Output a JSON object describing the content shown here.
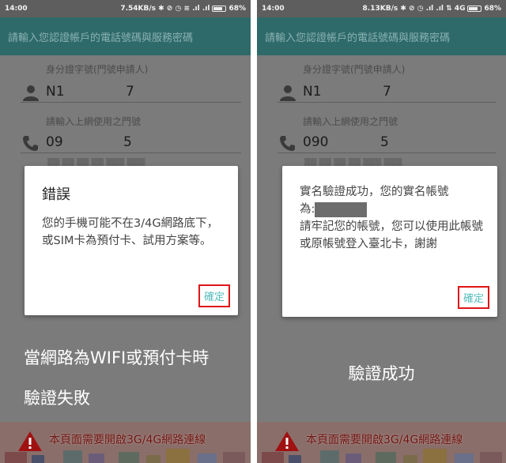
{
  "left": {
    "status": {
      "time": "14:00",
      "right": "7.54KB/s ✱ ⊘ ◷ ≋ .ıl .ıl",
      "battery": "68%"
    },
    "header": "請輸入您認證帳戶的電話號碼與服務密碼",
    "id_label": "身分證字號(門號申請人)",
    "id_prefix": "N1",
    "id_suffix": "7",
    "phone_label": "請輸入上網使用之門號",
    "phone_prefix": "09",
    "phone_suffix": "5",
    "dialog": {
      "title": "錯誤",
      "body": "您的手機可能不在3/4G網路底下，或SIM卡為預付卡、試用方案等。",
      "button": "確定"
    },
    "caption_line1": "當網路為WIFI或預付卡時",
    "caption_line2": "驗證失敗",
    "banner_text": "本頁面需要開啟3G/4G網路連線"
  },
  "right": {
    "status": {
      "time": "14:00",
      "right": "8.13KB/s ✱ ⊘ ◷ .ıl .ıl ⇅ 4G",
      "battery": "68%"
    },
    "header": "請輸入您認證帳戶的電話號碼與服務密碼",
    "id_label": "身分證字號(門號申請人)",
    "id_prefix": "N1",
    "id_suffix": "7",
    "phone_label": "請輸入上網使用之門號",
    "phone_prefix": "090",
    "phone_suffix": "5",
    "dialog": {
      "line1": "實名驗證成功，您的實名帳號",
      "line2": "為:",
      "line3": "請牢記您的帳號，您可以使用此帳號或原帳號登入臺北卡，謝謝",
      "button": "確定"
    },
    "caption": "驗證成功",
    "banner_text": "本頁面需要開啟3G/4G網路連線"
  },
  "colors": {
    "header": "#2f6a6a",
    "dim_overlay": "#7b7b7b",
    "button_text": "#55bcbc",
    "highlight_border": "#e01515"
  }
}
